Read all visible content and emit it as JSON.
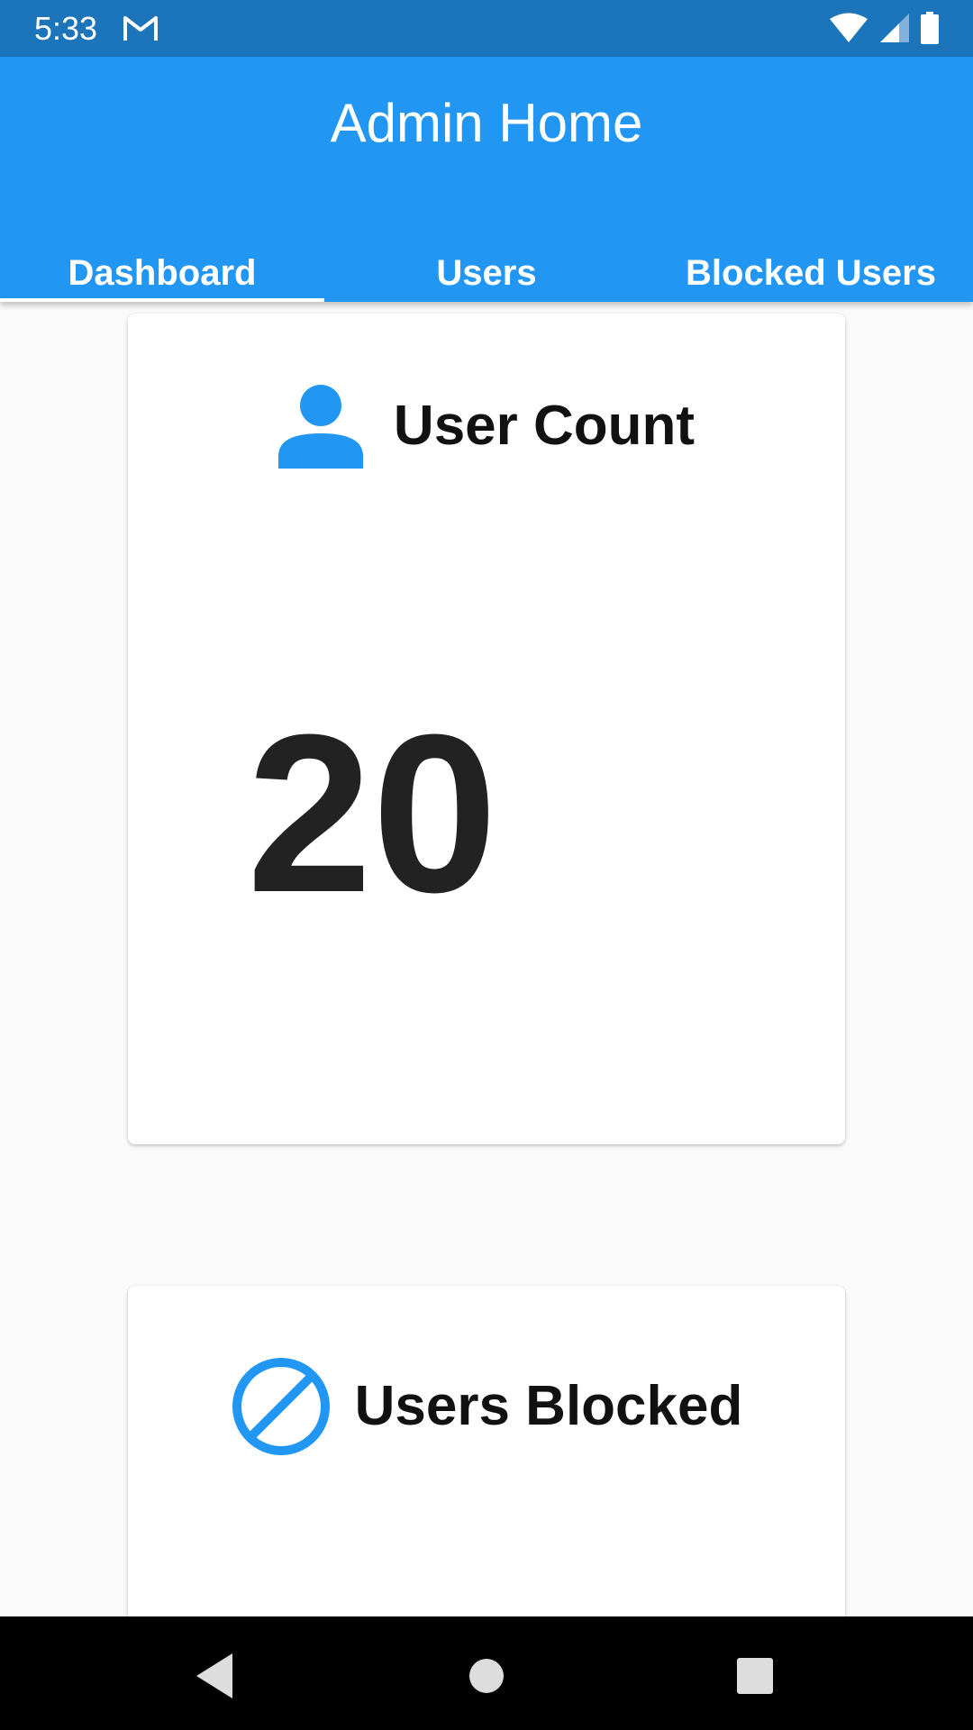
{
  "status_bar": {
    "time": "5:33",
    "notification_icon": "gmail-icon",
    "indicators": [
      "wifi-icon",
      "cellular-signal-icon",
      "battery-icon"
    ]
  },
  "app_bar": {
    "title": "Admin Home",
    "color": "#2196F3"
  },
  "tabs": [
    {
      "label": "Dashboard",
      "selected": true
    },
    {
      "label": "Users",
      "selected": false
    },
    {
      "label": "Blocked Users",
      "selected": false
    }
  ],
  "cards": {
    "user_count": {
      "icon": "person-icon",
      "title": "User Count",
      "value": "20"
    },
    "users_blocked": {
      "icon": "block-icon",
      "title": "Users Blocked"
    }
  },
  "nav_bar": {
    "buttons": [
      "back-icon",
      "home-icon",
      "recents-icon"
    ]
  },
  "colors": {
    "status_bar": "#1C74BA",
    "accent": "#2196F3",
    "background": "#FAFAFA"
  }
}
